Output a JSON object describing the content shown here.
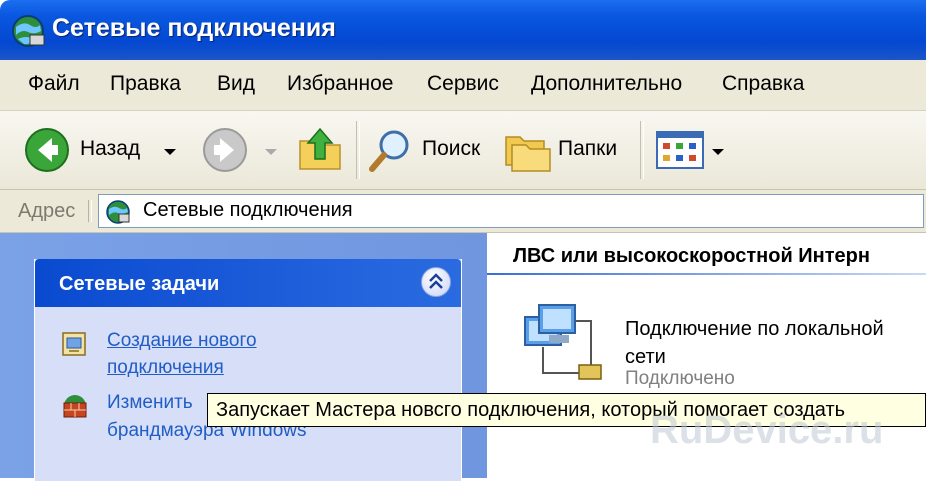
{
  "window": {
    "title": "Сетевые подключения"
  },
  "menubar": {
    "items": [
      "Файл",
      "Правка",
      "Вид",
      "Избранное",
      "Сервис",
      "Дополнительно",
      "Справка"
    ]
  },
  "toolbar": {
    "back_label": "Назад",
    "search_label": "Поиск",
    "folders_label": "Папки"
  },
  "addressbar": {
    "label": "Адрес",
    "value": "Сетевые подключения"
  },
  "taskpane": {
    "title": "Сетевые задачи",
    "tasks": [
      {
        "line1": "Создание нового",
        "line2": "подключения"
      },
      {
        "line1": "Изменить",
        "line2": "брандмауэра Windows"
      }
    ]
  },
  "content": {
    "group_header": "ЛВС или высокоскоростной Интерн",
    "item": {
      "name_line1": "Подключение по локальной",
      "name_line2": "сети",
      "status": "Подключено"
    }
  },
  "tooltip": {
    "text": "Запускает Мастера новсго подключения, который помогает создать"
  },
  "watermark": {
    "text": "RuDevice.ru"
  },
  "colors": {
    "titlebar": "#0448d2",
    "chrome": "#ece9d8",
    "task_header": "#0a4ad0",
    "link": "#215dc6",
    "tooltip_bg": "#ffffe1"
  }
}
